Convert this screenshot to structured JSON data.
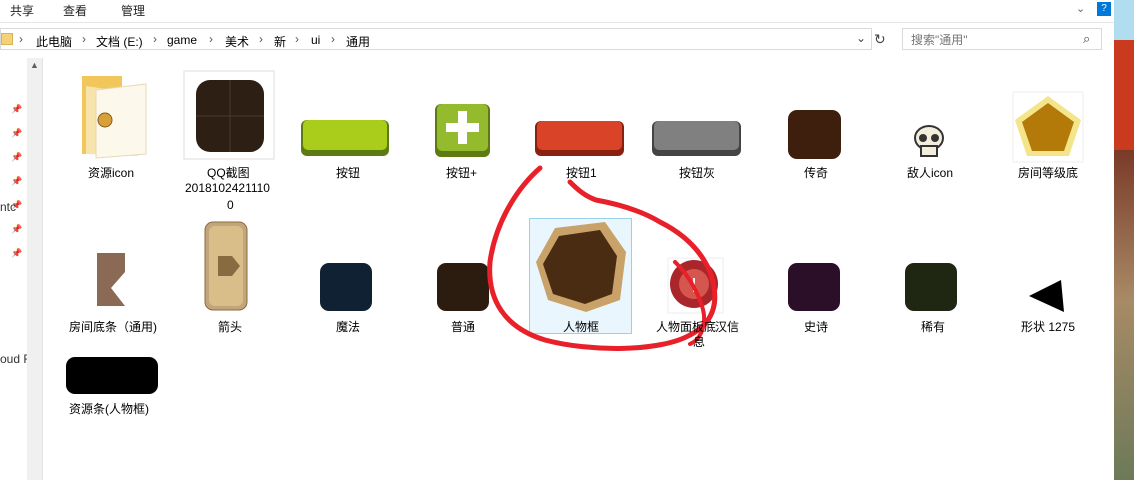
{
  "ribbon": {
    "tabs": [
      "共享",
      "查看",
      "管理"
    ]
  },
  "address": {
    "crumbs": [
      "此电脑",
      "文档 (E:)",
      "game",
      "美术",
      "新",
      "ui",
      "通用"
    ]
  },
  "search": {
    "placeholder": "搜索\"通用\""
  },
  "left_pane_texts": [
    "ntc",
    "oud F"
  ],
  "items": [
    {
      "label": "资源icon",
      "line2": ""
    },
    {
      "label": "QQ截图",
      "line2": "2018102421110",
      "line3": "0"
    },
    {
      "label": "按钮"
    },
    {
      "label": "按钮+"
    },
    {
      "label": "按钮1"
    },
    {
      "label": "按钮灰"
    },
    {
      "label": "传奇"
    },
    {
      "label": "敌人icon"
    },
    {
      "label": "房间等级底"
    },
    {
      "label": "房间底条（通用)"
    },
    {
      "label": "箭头"
    },
    {
      "label": "魔法"
    },
    {
      "label": "普通"
    },
    {
      "label": "人物框"
    },
    {
      "label": "人物面板底",
      "line2": "息"
    },
    {
      "label": "史诗"
    },
    {
      "label": "稀有"
    },
    {
      "label": "形状 1275"
    },
    {
      "label": "资源条(人物框)"
    },
    {
      "label": "汉信"
    }
  ],
  "colors": {
    "annotation": "#e8202a",
    "selection": "#99d1ea",
    "accent": "#0078d7"
  }
}
